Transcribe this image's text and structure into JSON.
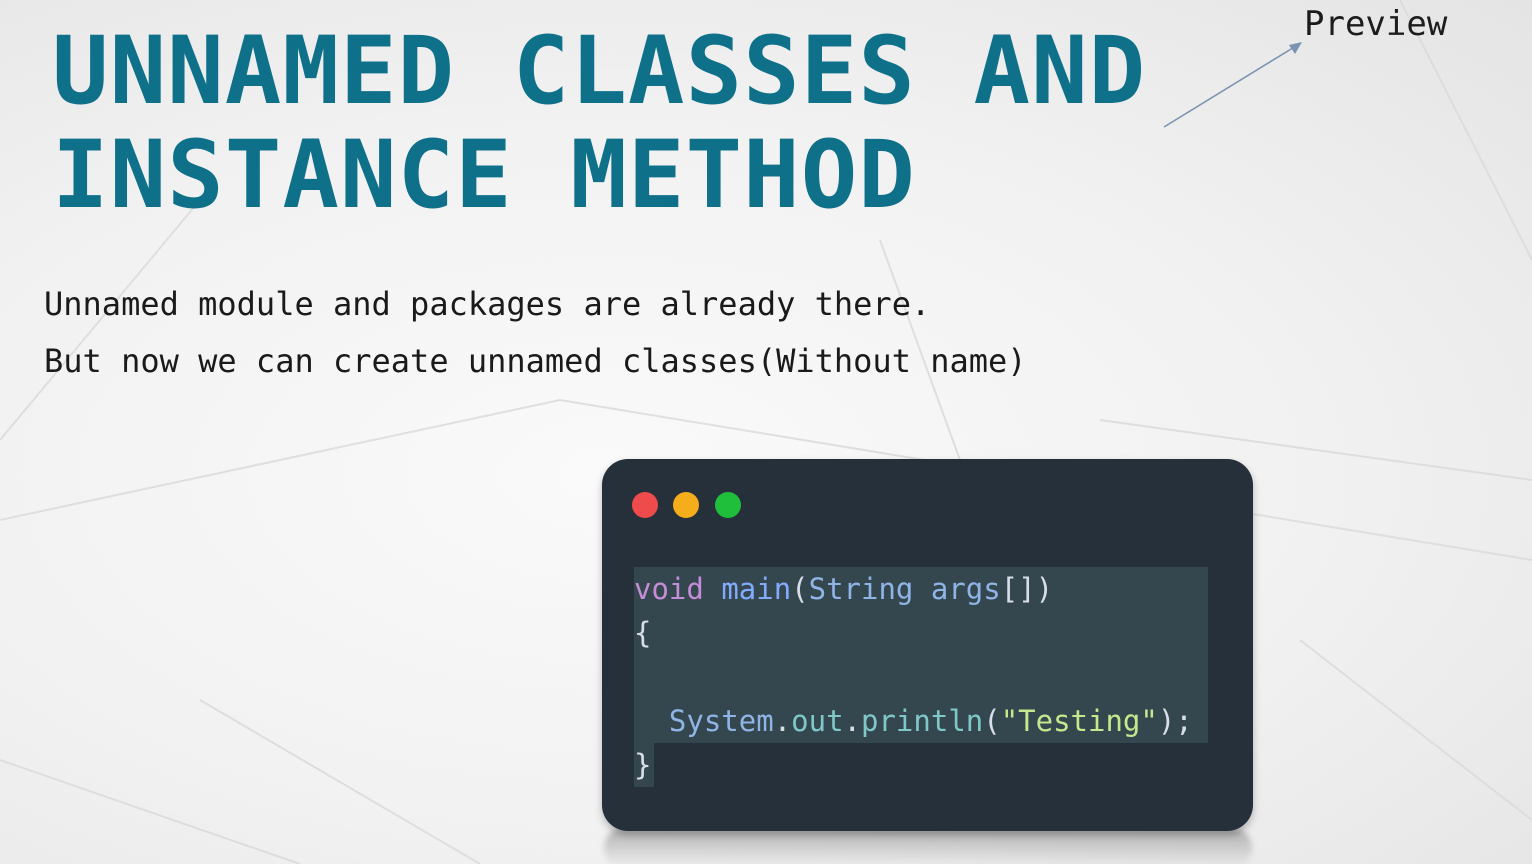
{
  "slide": {
    "title_line1": "UNNAMED CLASSES AND",
    "title_line2": "INSTANCE METHOD",
    "preview_label": "Preview",
    "body_line1": "Unnamed module and packages are already there.",
    "body_line2": "But now we can create unnamed classes(Without name)"
  },
  "code_window": {
    "buttons": [
      "close",
      "minimize",
      "maximize"
    ],
    "code": {
      "kw_void": "void",
      "fn_main": "main",
      "paren_open": "(",
      "type_string": "String",
      "param_args": "args",
      "brackets_close": "[])",
      "brace_open": "{",
      "obj_system": "System",
      "dot1": ".",
      "prop_out": "out",
      "dot2": ".",
      "fn_println": "println",
      "paren_open2": "(",
      "str_testing": "\"Testing\"",
      "paren_close_semi": ");",
      "brace_close": "}"
    }
  },
  "colors": {
    "title": "#0f7089",
    "code_bg": "#26303a",
    "code_highlight": "#35474e",
    "dot_red": "#ef4a4c",
    "dot_yellow": "#f5ad1b",
    "dot_green": "#1fbe3b"
  }
}
